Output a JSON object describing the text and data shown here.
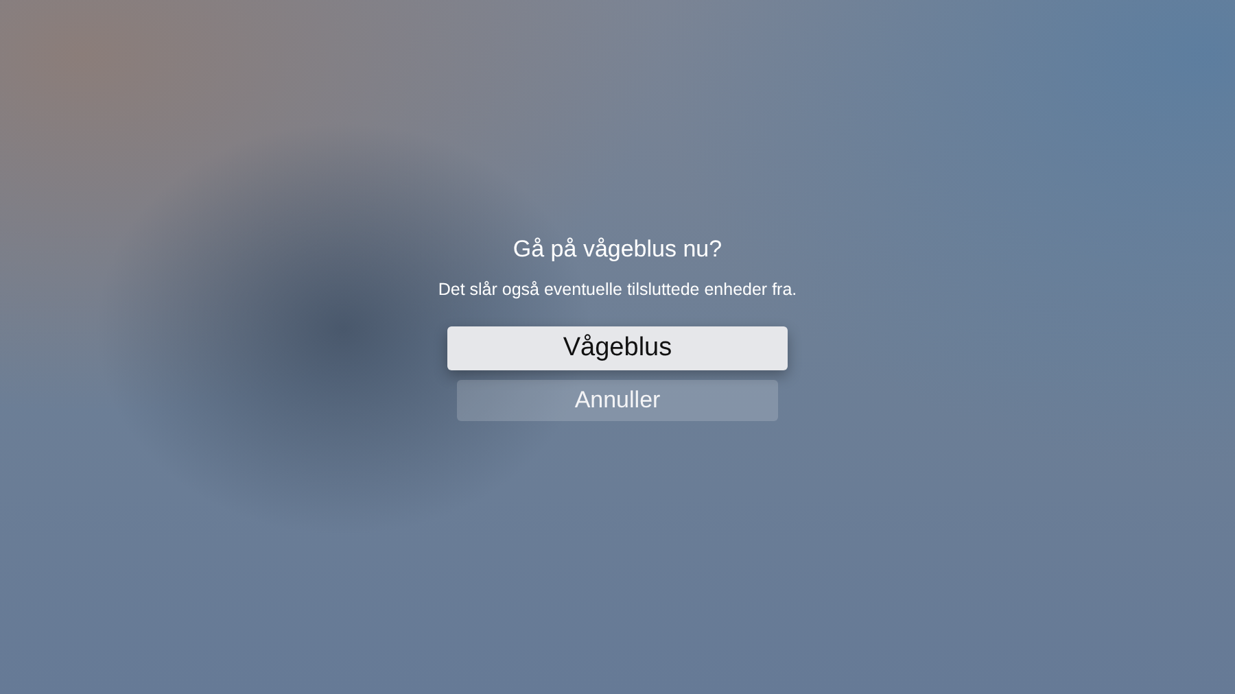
{
  "dialog": {
    "title": "Gå på vågeblus nu?",
    "message": "Det slår også eventuelle tilsluttede enheder fra.",
    "buttons": [
      {
        "label": "Vågeblus",
        "selected": true
      },
      {
        "label": "Annuller",
        "selected": false
      }
    ]
  }
}
